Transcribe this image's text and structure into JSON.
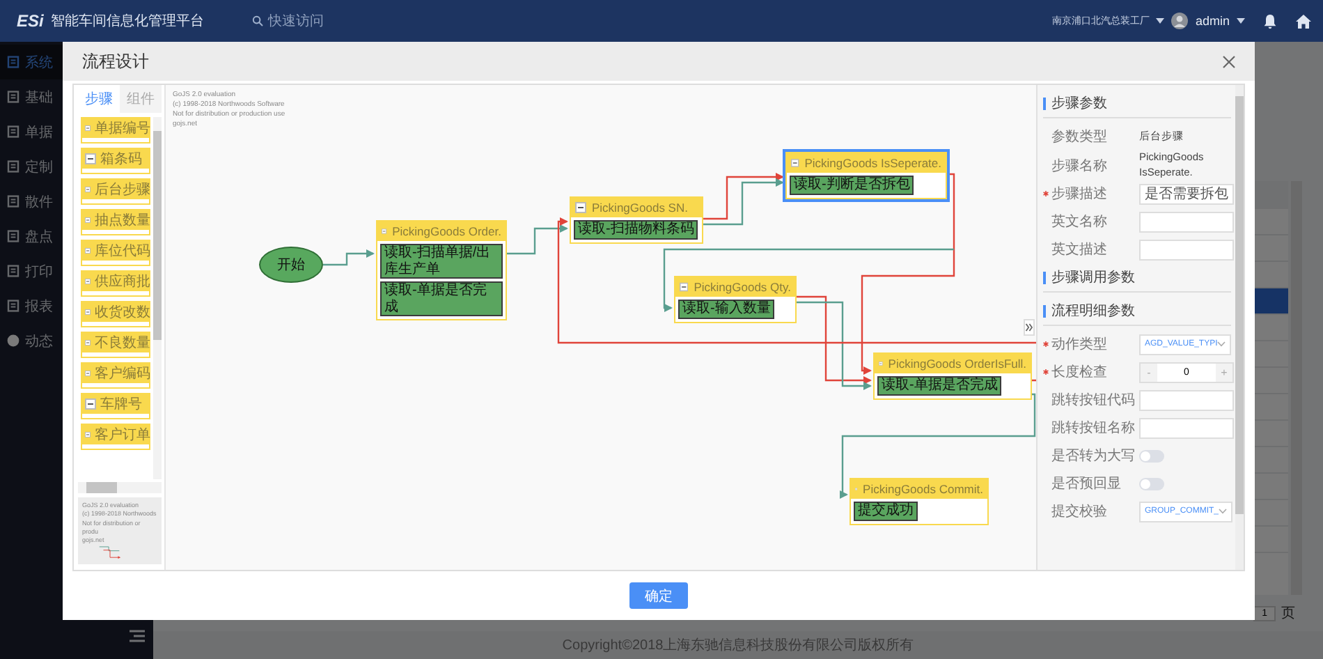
{
  "header": {
    "logo": "ESi",
    "title": "智能车间信息化管理平台",
    "search_placeholder": "快速访问",
    "factory": "南京浦口北汽总装工厂",
    "user": "admin"
  },
  "sidebar": {
    "items": [
      {
        "label": "系统",
        "selected": true
      },
      {
        "label": "基础",
        "selected": false
      },
      {
        "label": "单据",
        "selected": false
      },
      {
        "label": "定制",
        "selected": false
      },
      {
        "label": "散件",
        "selected": false
      },
      {
        "label": "盘点",
        "selected": false
      },
      {
        "label": "打印",
        "selected": false
      },
      {
        "label": "报表",
        "selected": false
      },
      {
        "label": "动态",
        "selected": false
      }
    ]
  },
  "background_list": {
    "rows": [
      {
        "selected": false
      },
      {
        "selected": false
      },
      {
        "selected": false
      },
      {
        "selected": true
      },
      {
        "selected": false
      },
      {
        "selected": false
      },
      {
        "selected": false
      },
      {
        "selected": false
      },
      {
        "selected": false
      },
      {
        "selected": false
      },
      {
        "selected": false
      },
      {
        "selected": false
      },
      {
        "selected": false
      }
    ],
    "page": "1",
    "page_unit": "页"
  },
  "footer": {
    "copyright": "Copyright©2018上海东驰信息科技股份有限公司版权所有"
  },
  "dialog": {
    "title": "流程设计",
    "palette": {
      "tabs": [
        {
          "label": "步骤",
          "selected": true
        },
        {
          "label": "组件",
          "selected": false
        }
      ],
      "items": [
        "单据编号",
        "箱条码",
        "后台步骤",
        "抽点数量",
        "库位代码",
        "供应商批",
        "收货改数",
        "不良数量",
        "客户编码",
        "车牌号",
        "客户订单"
      ],
      "overview_watermark": [
        "GoJS 2.0 evaluation",
        "(c) 1998-2018 Northwoods",
        "Not for distribution or produ",
        "gojs.net"
      ]
    },
    "canvas": {
      "watermark": [
        "GoJS 2.0 evaluation",
        "(c) 1998-2018 Northwoods Software",
        "Not for distribution or production use",
        "gojs.net"
      ],
      "start": "开始",
      "nodes": [
        {
          "title": "PickingGoods Order.",
          "selected": false,
          "items": [
            "读取-扫描单据/出库生产单",
            "读取-单据是否完成"
          ]
        },
        {
          "title": "PickingGoods SN.",
          "selected": false,
          "items": [
            "读取-扫描物料条码"
          ]
        },
        {
          "title": "PickingGoods IsSeperate.",
          "selected": true,
          "items": [
            "读取-判断是否拆包"
          ]
        },
        {
          "title": "PickingGoods Qty.",
          "selected": false,
          "items": [
            "读取-输入数量"
          ]
        },
        {
          "title": "PickingGoods OrderIsFull.",
          "selected": false,
          "items": [
            "读取-单据是否完成"
          ]
        },
        {
          "title": "PickingGoods Commit.",
          "selected": false,
          "items": [
            "提交成功"
          ]
        }
      ]
    },
    "properties": {
      "sections": [
        {
          "title": "步骤参数",
          "fields": [
            {
              "kind": "text",
              "label": "参数类型",
              "value": "后台步骤"
            },
            {
              "kind": "text",
              "label": "步骤名称",
              "value": "PickingGoods IsSeperate."
            },
            {
              "kind": "input",
              "label": "步骤描述",
              "required": true,
              "value": "是否需要拆包"
            },
            {
              "kind": "input",
              "label": "英文名称",
              "required": false
            },
            {
              "kind": "input",
              "label": "英文描述",
              "required": false
            }
          ]
        },
        {
          "title": "步骤调用参数"
        },
        {
          "title": "流程明细参数",
          "fields": [
            {
              "kind": "select",
              "label": "动作类型",
              "required": true,
              "value": "AGD_VALUE_TYPI"
            },
            {
              "kind": "stepper",
              "label": "长度检查",
              "required": true,
              "value": "0",
              "minus": "-",
              "plus": "+"
            },
            {
              "kind": "input",
              "label": "跳转按钮代码",
              "required": false
            },
            {
              "kind": "input",
              "label": "跳转按钮名称",
              "required": false
            },
            {
              "kind": "toggle",
              "label": "是否转为大写",
              "on": false
            },
            {
              "kind": "toggle",
              "label": "是否预回显",
              "on": false
            },
            {
              "kind": "select",
              "label": "提交校验",
              "required": false,
              "value": "GROUP_COMMIT_"
            }
          ]
        }
      ]
    },
    "confirm": "确定"
  }
}
